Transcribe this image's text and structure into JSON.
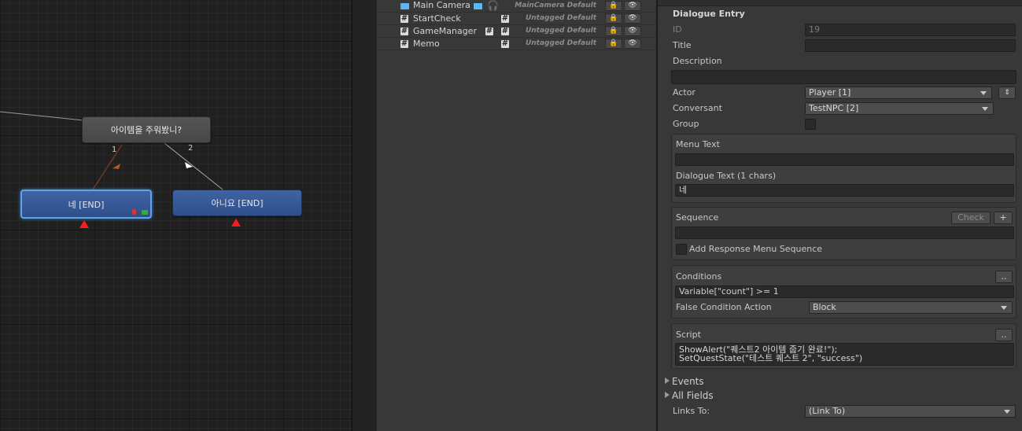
{
  "graph": {
    "nodes": {
      "question": "아이템을 주워봤니?",
      "yes": "네 [END]",
      "no": "아니요 [END]"
    },
    "link_labels": [
      "1",
      "2"
    ]
  },
  "hierarchy": {
    "rows": [
      {
        "name": "Main Camera",
        "tag": "MainCamera",
        "layer": "Default",
        "icon": "camera-icon"
      },
      {
        "name": "StartCheck",
        "tag": "Untagged",
        "layer": "Default",
        "icon": "script-icon"
      },
      {
        "name": "GameManager",
        "tag": "Untagged",
        "layer": "Default",
        "icon": "script-icon"
      },
      {
        "name": "Memo",
        "tag": "Untagged",
        "layer": "Default",
        "icon": "script-icon"
      }
    ]
  },
  "inspector": {
    "header": "Dialogue Entry",
    "id_label": "ID",
    "id_value": "19",
    "title_label": "Title",
    "title_value": "",
    "description_label": "Description",
    "description_value": "",
    "actor_label": "Actor",
    "actor_value": "Player [1]",
    "conversant_label": "Conversant",
    "conversant_value": "TestNPC [2]",
    "group_label": "Group",
    "menu_text_label": "Menu Text",
    "menu_text_value": "",
    "dialogue_text_label": "Dialogue Text (1 chars)",
    "dialogue_text_value": "네",
    "sequence_label": "Sequence",
    "check_button": "Check",
    "plus_button": "+",
    "sequence_value": "",
    "add_response_label": "Add Response Menu Sequence",
    "conditions_label": "Conditions",
    "ellipsis_button": "..",
    "conditions_value": "Variable[\"count\"] >= 1",
    "false_condition_label": "False Condition Action",
    "false_condition_value": "Block",
    "script_label": "Script",
    "script_value": "ShowAlert(\"퀘스트2 아이템 줍기 완료!\");\nSetQuestState(\"테스트 퀘스트 2\", \"success\")",
    "events_label": "Events",
    "all_fields_label": "All Fields",
    "links_to_label": "Links To:",
    "links_to_value": "(Link To)"
  }
}
